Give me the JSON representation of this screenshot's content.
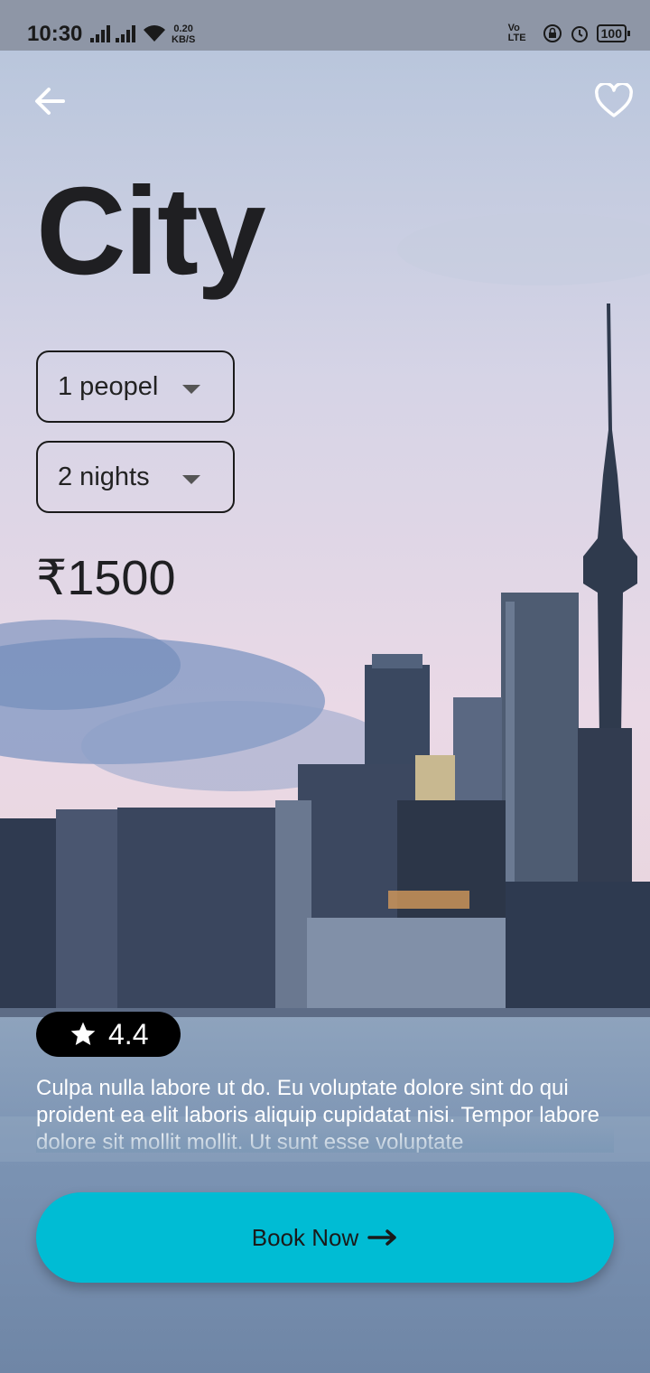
{
  "status_bar": {
    "time": "10:30",
    "net_speed_value": "0.20",
    "net_speed_unit": "KB/S",
    "volte": "Vo LTE",
    "battery": "100"
  },
  "place": {
    "title": "City",
    "people_select": "1 peopel",
    "nights_select": "2 nights",
    "price": "₹1500",
    "rating": "4.4",
    "description": "Culpa nulla labore ut do. Eu voluptate dolore sint do qui proident ea elit laboris aliquip cupidatat nisi. Tempor labore dolore sit mollit mollit. Ut sunt esse voluptate",
    "book_label": "Book Now"
  },
  "colors": {
    "accent": "#00bcd4",
    "title_text": "#1f1f22",
    "rating_bg": "#000000"
  },
  "icons": {
    "back": "arrow-left-icon",
    "favorite": "heart-outline-icon",
    "rating": "star-icon",
    "book": "arrow-right-icon"
  }
}
